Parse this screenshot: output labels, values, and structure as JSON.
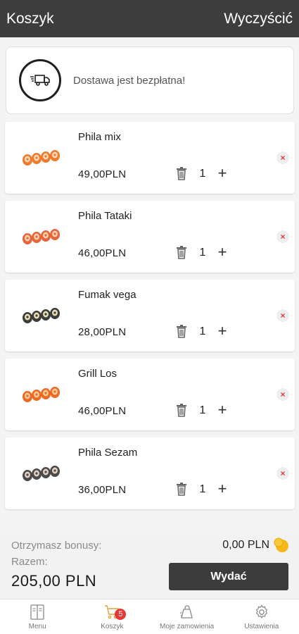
{
  "header": {
    "title": "Koszyk",
    "clear_label": "Wyczyścić"
  },
  "delivery": {
    "icon": "delivery-truck-icon",
    "text": "Dostawa jest bezpłatna!"
  },
  "cart_items": [
    {
      "name": "Phila mix",
      "price": "49,00PLN",
      "quantity": "1",
      "plus": "+",
      "remove": "×"
    },
    {
      "name": "Phila Tataki",
      "price": "46,00PLN",
      "quantity": "1",
      "plus": "+",
      "remove": "×"
    },
    {
      "name": "Fumak vega",
      "price": "28,00PLN",
      "quantity": "1",
      "plus": "+",
      "remove": "×"
    },
    {
      "name": "Grill Los",
      "price": "46,00PLN",
      "quantity": "1",
      "plus": "+",
      "remove": "×"
    },
    {
      "name": "Phila Sezam",
      "price": "36,00PLN",
      "quantity": "1",
      "plus": "+",
      "remove": "×"
    }
  ],
  "summary": {
    "bonus_label": "Otrzymasz bonusy:",
    "bonus_value": "0,00 PLN",
    "total_label": "Razem:",
    "total_value": "205,00 PLN",
    "spend_button": "Wydać"
  },
  "tabbar": {
    "items": [
      {
        "label": "Menu",
        "icon": "menu-book-icon"
      },
      {
        "label": "Koszyk",
        "icon": "cart-icon",
        "badge": "5"
      },
      {
        "label": "Moje zamowienia",
        "icon": "orders-bag-icon"
      },
      {
        "label": "Ustawienia",
        "icon": "gear-icon"
      }
    ]
  },
  "colors": {
    "header_bg": "#3d3d3d",
    "badge": "#e53935",
    "remove_x": "#e53935",
    "cart_accent": "#e0a030",
    "coin": "#f5c518"
  }
}
